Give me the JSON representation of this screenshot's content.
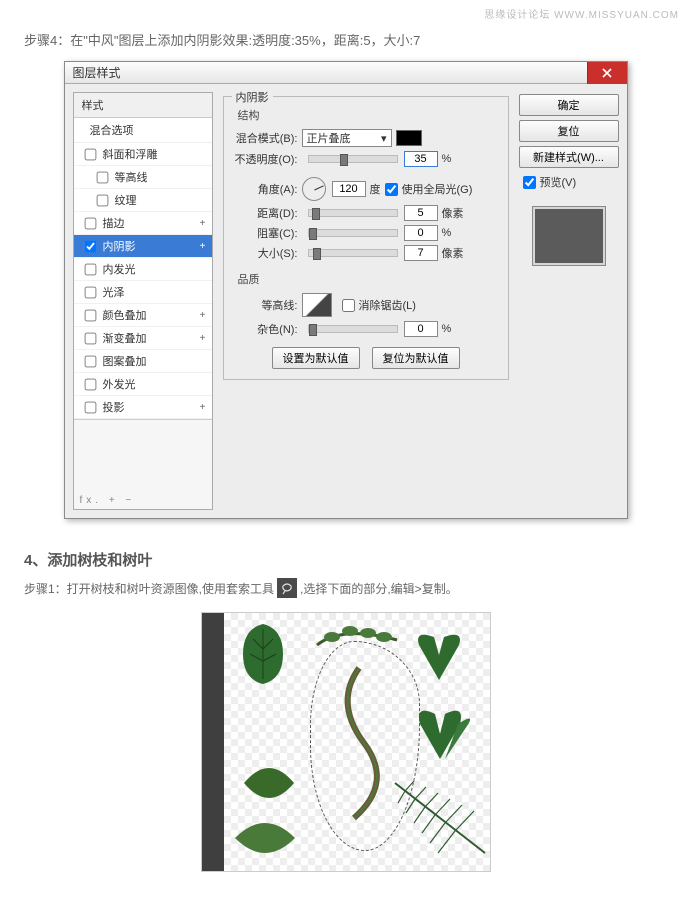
{
  "watermark": "思缘设计论坛  WWW.MISSYUAN.COM",
  "step4_text": "步骤4：在\"中风\"图层上添加内阴影效果:透明度:35%，距离:5，大小:7",
  "dialog": {
    "title": "图层样式",
    "sidebar": {
      "head": "样式",
      "sub": "混合选项",
      "items": [
        {
          "label": "斜面和浮雕",
          "checked": false,
          "plus": false
        },
        {
          "label": "等高线",
          "checked": false,
          "plus": false
        },
        {
          "label": "纹理",
          "checked": false,
          "plus": false
        },
        {
          "label": "描边",
          "checked": false,
          "plus": true
        },
        {
          "label": "内阴影",
          "checked": true,
          "plus": true,
          "selected": true
        },
        {
          "label": "内发光",
          "checked": false,
          "plus": false
        },
        {
          "label": "光泽",
          "checked": false,
          "plus": false
        },
        {
          "label": "颜色叠加",
          "checked": false,
          "plus": true
        },
        {
          "label": "渐变叠加",
          "checked": false,
          "plus": true
        },
        {
          "label": "图案叠加",
          "checked": false,
          "plus": false
        },
        {
          "label": "外发光",
          "checked": false,
          "plus": false
        },
        {
          "label": "投影",
          "checked": false,
          "plus": true
        }
      ],
      "footer": "fx.  +  −"
    },
    "panel": {
      "legend": "内阴影",
      "structure_label": "结构",
      "blend_label": "混合模式(B):",
      "blend_value": "正片叠底",
      "opacity_label": "不透明度(O):",
      "opacity_value": "35",
      "opacity_unit": "%",
      "angle_label": "角度(A):",
      "angle_value": "120",
      "angle_unit": "度",
      "global_light_label": "使用全局光(G)",
      "distance_label": "距离(D):",
      "distance_value": "5",
      "distance_unit": "像素",
      "choke_label": "阻塞(C):",
      "choke_value": "0",
      "choke_unit": "%",
      "size_label": "大小(S):",
      "size_value": "7",
      "size_unit": "像素",
      "quality_label": "品质",
      "contour_label": "等高线:",
      "anti_alias_label": "消除锯齿(L)",
      "noise_label": "杂色(N):",
      "noise_value": "0",
      "noise_unit": "%",
      "make_default": "设置为默认值",
      "reset_default": "复位为默认值"
    },
    "right": {
      "ok": "确定",
      "reset": "复位",
      "new_style": "新建样式(W)...",
      "preview": "预览(V)"
    }
  },
  "section4_title": "4、添加树枝和树叶",
  "step1_prefix": "步骤1：打开树枝和树叶资源图像,使用套索工具",
  "step1_suffix": ",选择下面的部分,编辑>复制。"
}
